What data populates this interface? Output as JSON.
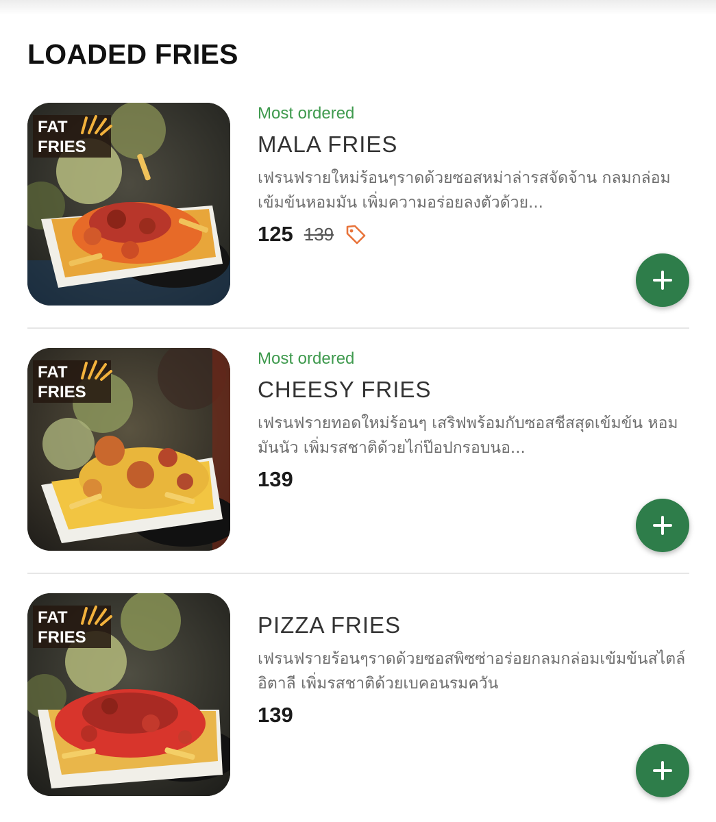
{
  "section": {
    "title": "LOADED FRIES"
  },
  "colors": {
    "accent_green": "#2e7d4a",
    "badge_green": "#3f9a4e",
    "tag_orange": "#e8733a"
  },
  "items": [
    {
      "badge": "Most ordered",
      "name": "MALA FRIES",
      "description": "เฟรนฟรายใหม่ร้อนๆราดด้วยซอสหม่าล่ารสจัดจ้าน กลมกล่อมเข้มข้นหอมมัน เพิ่มความอร่อยลงตัวด้วย...",
      "price": "125",
      "old_price": "139",
      "image_logo": "FAT FRIES",
      "image_icon": "fries-photo",
      "add_icon": "plus-icon"
    },
    {
      "badge": "Most ordered",
      "name": "CHEESY FRIES",
      "description": "เฟรนฟรายทอดใหม่ร้อนๆ เสริฟพร้อมกับซอสชีสสุดเข้มข้น หอมมันนัว เพิ่มรสชาติด้วยไก่ป๊อปกรอบนอ...",
      "price": "139",
      "image_logo": "FAT FRIES",
      "image_icon": "fries-photo",
      "add_icon": "plus-icon"
    },
    {
      "name": "PIZZA FRIES",
      "description": "เฟรนฟรายร้อนๆราดด้วยซอสพิซซ่าอร่อยกลมกล่อมเข้มข้นสไตล์อิตาลี เพิ่มรสชาติด้วยเบคอนรมควัน",
      "price": "139",
      "image_logo": "FAT FRIES",
      "image_icon": "fries-photo",
      "add_icon": "plus-icon"
    }
  ]
}
